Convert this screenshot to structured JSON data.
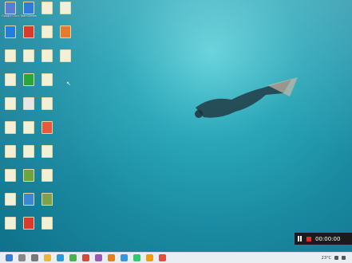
{
  "desktop": {
    "icons": [
      {
        "label": "Google Chrome",
        "col": 0,
        "row": 0,
        "color": "#5b7bd9"
      },
      {
        "label": "TeamViewer",
        "col": 1,
        "row": 0,
        "color": "#2f7bdc"
      },
      {
        "label": "",
        "col": 2,
        "row": 0,
        "color": "#f3f0d8"
      },
      {
        "label": "",
        "col": 3,
        "row": 0,
        "color": "#f3f0d8"
      },
      {
        "label": "",
        "col": 0,
        "row": 1,
        "color": "#1f7fe0"
      },
      {
        "label": "",
        "col": 1,
        "row": 1,
        "color": "#d83a2e"
      },
      {
        "label": "",
        "col": 2,
        "row": 1,
        "color": "#f3f0d8"
      },
      {
        "label": "",
        "col": 3,
        "row": 1,
        "color": "#e67c2b"
      },
      {
        "label": "",
        "col": 0,
        "row": 2,
        "color": "#f3f0d8"
      },
      {
        "label": "",
        "col": 1,
        "row": 2,
        "color": "#f3f0d8"
      },
      {
        "label": "",
        "col": 2,
        "row": 2,
        "color": "#f3f0d8"
      },
      {
        "label": "",
        "col": 3,
        "row": 2,
        "color": "#f3f0d8"
      },
      {
        "label": "",
        "col": 0,
        "row": 3,
        "color": "#f3f0d8"
      },
      {
        "label": "",
        "col": 1,
        "row": 3,
        "color": "#2aa53c"
      },
      {
        "label": "",
        "col": 2,
        "row": 3,
        "color": "#f3f0d8"
      },
      {
        "label": "",
        "col": 0,
        "row": 4,
        "color": "#f3f0d8"
      },
      {
        "label": "",
        "col": 1,
        "row": 4,
        "color": "#e6e6e6"
      },
      {
        "label": "",
        "col": 2,
        "row": 4,
        "color": "#f3f0d8"
      },
      {
        "label": "",
        "col": 0,
        "row": 5,
        "color": "#f3f0d8"
      },
      {
        "label": "",
        "col": 1,
        "row": 5,
        "color": "#f3f0d8"
      },
      {
        "label": "",
        "col": 2,
        "row": 5,
        "color": "#e8583b"
      },
      {
        "label": "",
        "col": 0,
        "row": 6,
        "color": "#f3f0d8"
      },
      {
        "label": "",
        "col": 1,
        "row": 6,
        "color": "#f3f0d8"
      },
      {
        "label": "",
        "col": 2,
        "row": 6,
        "color": "#f3f0d8"
      },
      {
        "label": "",
        "col": 0,
        "row": 7,
        "color": "#f3f0d8"
      },
      {
        "label": "",
        "col": 1,
        "row": 7,
        "color": "#6fa340"
      },
      {
        "label": "",
        "col": 2,
        "row": 7,
        "color": "#f3f0d8"
      },
      {
        "label": "",
        "col": 0,
        "row": 8,
        "color": "#f3f0d8"
      },
      {
        "label": "",
        "col": 1,
        "row": 8,
        "color": "#3a87d4"
      },
      {
        "label": "",
        "col": 2,
        "row": 8,
        "color": "#7aa34a"
      },
      {
        "label": "",
        "col": 0,
        "row": 9,
        "color": "#f3f0d8"
      },
      {
        "label": "",
        "col": 1,
        "row": 9,
        "color": "#d83a2e"
      },
      {
        "label": "",
        "col": 2,
        "row": 9,
        "color": "#f3f0d8"
      }
    ]
  },
  "recorder": {
    "time": "00:00:00",
    "stop_color": "#e02b2b"
  },
  "taskbar": {
    "items": [
      {
        "name": "start-icon",
        "color": "#3a7bd5"
      },
      {
        "name": "search-icon",
        "color": "#888888"
      },
      {
        "name": "taskview-icon",
        "color": "#777777"
      },
      {
        "name": "folder-icon",
        "color": "#e8b63a"
      },
      {
        "name": "edge-icon",
        "color": "#2a9ad6"
      },
      {
        "name": "chrome-icon",
        "color": "#4caf50"
      },
      {
        "name": "app-icon",
        "color": "#d34a3a"
      },
      {
        "name": "app-icon",
        "color": "#9b59b6"
      },
      {
        "name": "app-icon",
        "color": "#e67e22"
      },
      {
        "name": "app-icon",
        "color": "#3498db"
      },
      {
        "name": "app-icon",
        "color": "#2ecc71"
      },
      {
        "name": "app-icon",
        "color": "#f39c12"
      },
      {
        "name": "app-icon",
        "color": "#e74c3c"
      }
    ],
    "weather": "23°C",
    "clock": ""
  }
}
